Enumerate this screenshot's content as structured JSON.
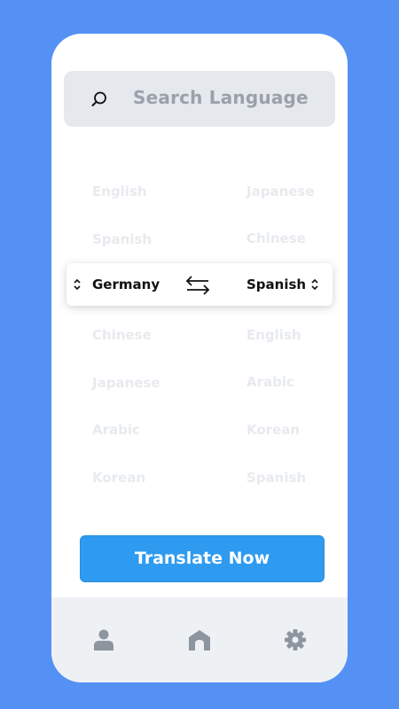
{
  "search": {
    "placeholder": "Search Language"
  },
  "languages": {
    "left": [
      "English",
      "Spanish",
      "Chinese",
      "Japanese",
      "Arabic",
      "Korean"
    ],
    "right": [
      "Japanese",
      "Chinese",
      "English",
      "Arabic",
      "Korean",
      "Spanish"
    ]
  },
  "selector": {
    "source": "Germany",
    "target": "Spanish"
  },
  "cta": {
    "label": "Translate Now"
  },
  "tabbar": {
    "items": [
      {
        "icon": "user-icon"
      },
      {
        "icon": "home-icon"
      },
      {
        "icon": "gear-icon"
      }
    ]
  },
  "colors": {
    "background": "#5591f5",
    "accent": "#2f9bf0",
    "faded_text": "#e7eaee",
    "tabbar": "#eef1f4"
  }
}
